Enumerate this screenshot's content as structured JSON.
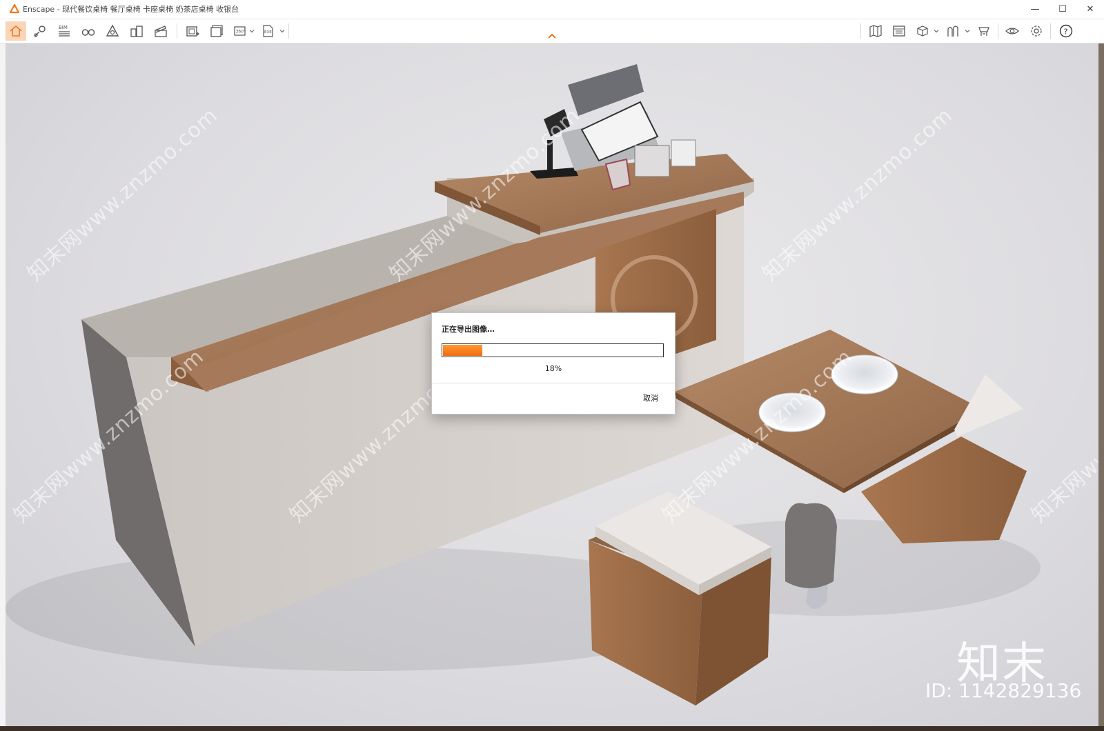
{
  "window": {
    "title": "Enscape - 现代餐饮桌椅 餐厅桌椅 卡座桌椅 奶茶店桌椅 收银台",
    "minimize_icon": "—",
    "maximize_icon": "☐",
    "close_icon": "✕",
    "accent_color": "#f07820"
  },
  "toolbar": {
    "left_buttons": [
      "home-icon",
      "location-icon",
      "bim-icon",
      "binoculars-icon",
      "perspective-icon",
      "buildings-icon",
      "clapperboard-icon"
    ],
    "export_buttons": [
      "screenshot-icon",
      "batch-render-icon",
      "panorama-360-icon",
      "export-exe-icon"
    ],
    "right_buttons": [
      "asset-library-icon",
      "material-editor-icon",
      "views-icon",
      "atmosphere-icon",
      "visual-settings-icon",
      "vr-headset-icon",
      "general-settings-icon",
      "help-icon"
    ],
    "bim_label": "BIM",
    "pano_label": "360°",
    "exe_label": "EXE",
    "help_label": "?"
  },
  "viewport": {
    "watermark_text": "知末网www.znzmo.com",
    "brand_logo": "知末",
    "brand_id": "ID: 1142829136"
  },
  "dialog": {
    "title": "正在导出图像…",
    "progress_percent": 18,
    "progress_label": "18%",
    "cancel_label": "取消"
  }
}
